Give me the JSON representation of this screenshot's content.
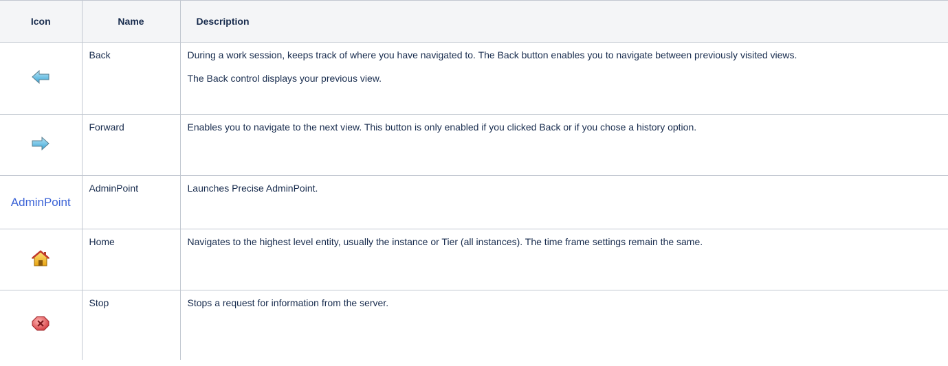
{
  "table": {
    "headers": {
      "icon": "Icon",
      "name": "Name",
      "description": "Description"
    },
    "rows": [
      {
        "icon": "back-arrow-icon",
        "name": "Back",
        "description": [
          "During a work session, keeps track of where you have navigated to. The Back button enables you to navigate between previously visited views.",
          "The Back control displays your previous view."
        ]
      },
      {
        "icon": "forward-arrow-icon",
        "name": "Forward",
        "description": [
          "Enables you to navigate to the next view. This button is only enabled if you clicked Back or if you chose a history option."
        ]
      },
      {
        "icon": "adminpoint-logo",
        "icon_text": "AdminPoint",
        "name": "AdminPoint",
        "description": [
          "Launches Precise AdminPoint."
        ]
      },
      {
        "icon": "home-icon",
        "name": "Home",
        "description": [
          "Navigates to the highest level entity, usually the instance or Tier (all instances). The time frame settings remain the same."
        ]
      },
      {
        "icon": "stop-icon",
        "name": "Stop",
        "description": [
          "Stops a request for information from the server."
        ]
      }
    ]
  },
  "colors": {
    "header_bg": "#f4f5f7",
    "border": "#c1c7d0",
    "text": "#172b4d",
    "arrow_blue": "#4fb3e0",
    "admin_logo": "#3a62d6",
    "home_yellow": "#f2c12e",
    "stop_red": "#d9474b"
  }
}
